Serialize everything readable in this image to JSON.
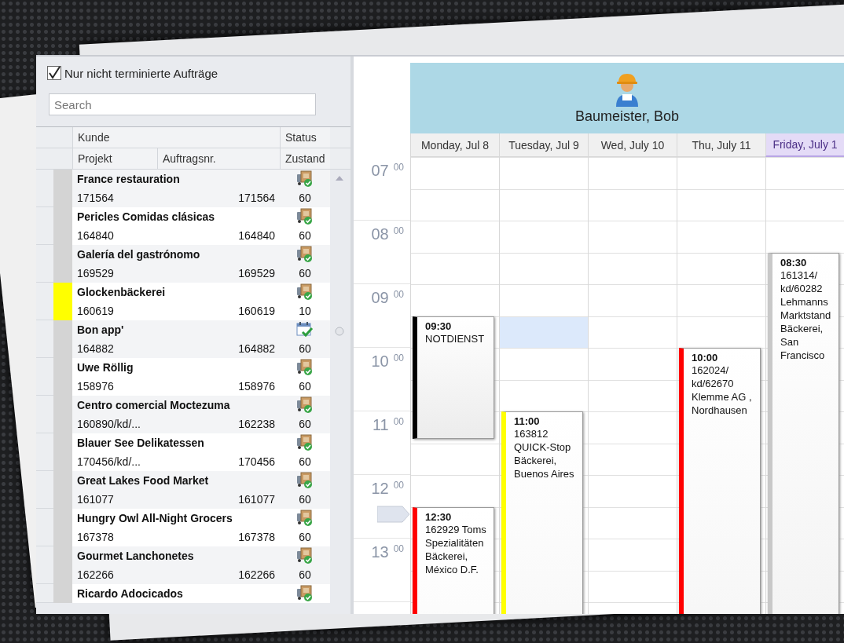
{
  "filter": {
    "label": "Nur nicht terminierte Aufträge",
    "checked": true
  },
  "search": {
    "placeholder": "Search"
  },
  "table": {
    "columns_top": [
      "Kunde",
      "Status"
    ],
    "columns_bottom": [
      "Projekt",
      "Auftragsnr.",
      "Zustand"
    ]
  },
  "orders": [
    {
      "customer": "France restauration",
      "project": "171564",
      "order_no": "171564",
      "state": "60",
      "kind": "truck",
      "color": "#d4d4d4"
    },
    {
      "customer": "Pericles Comidas clásicas",
      "project": "164840",
      "order_no": "164840",
      "state": "60",
      "kind": "truck",
      "color": "#d4d4d4"
    },
    {
      "customer": "Galería del gastrónomo",
      "project": "169529",
      "order_no": "169529",
      "state": "60",
      "kind": "truck",
      "color": "#d4d4d4"
    },
    {
      "customer": "Glockenbäckerei",
      "project": "160619",
      "order_no": "160619",
      "state": "10",
      "kind": "truck",
      "color": "#ffff00"
    },
    {
      "customer": "Bon app'",
      "project": "164882",
      "order_no": "164882",
      "state": "60",
      "kind": "calendar",
      "color": "#d4d4d4"
    },
    {
      "customer": "Uwe Röllig",
      "project": "158976",
      "order_no": "158976",
      "state": "60",
      "kind": "truck",
      "color": "#d4d4d4"
    },
    {
      "customer": "Centro comercial Moctezuma",
      "project": "160890/kd/...",
      "order_no": "162238",
      "state": "60",
      "kind": "truck",
      "color": "#d4d4d4"
    },
    {
      "customer": "Blauer See Delikatessen",
      "project": "170456/kd/...",
      "order_no": "170456",
      "state": "60",
      "kind": "truck",
      "color": "#d4d4d4"
    },
    {
      "customer": "Great Lakes Food Market",
      "project": "161077",
      "order_no": "161077",
      "state": "60",
      "kind": "truck",
      "color": "#d4d4d4"
    },
    {
      "customer": "Hungry Owl All-Night Grocers",
      "project": "167378",
      "order_no": "167378",
      "state": "60",
      "kind": "truck",
      "color": "#d4d4d4"
    },
    {
      "customer": "Gourmet Lanchonetes",
      "project": "162266",
      "order_no": "162266",
      "state": "60",
      "kind": "truck",
      "color": "#d4d4d4"
    },
    {
      "customer": "Ricardo Adocicados",
      "kind": "truck",
      "color": "#d4d4d4"
    }
  ],
  "calendar": {
    "resource": "Baumeister, Bob",
    "hours": [
      {
        "hour": "07",
        "minutes": "00",
        "now": false
      },
      {
        "hour": "08",
        "minutes": "00",
        "now": false
      },
      {
        "hour": "09",
        "minutes": "00",
        "now": false
      },
      {
        "hour": "10",
        "minutes": "00",
        "now": false
      },
      {
        "hour": "11",
        "minutes": "00",
        "now": false
      },
      {
        "hour": "12",
        "minutes": "00",
        "now": true
      },
      {
        "hour": "13",
        "minutes": "00",
        "now": false
      }
    ],
    "days": [
      {
        "label": "Monday, Jul 8",
        "highlighted": false,
        "slots": [
          {
            "selected": false
          },
          {
            "selected": false
          },
          {
            "selected": false
          },
          {
            "selected": false
          },
          {
            "selected": false
          },
          {
            "selected": false
          },
          {
            "selected": false
          },
          {
            "selected": false
          },
          {
            "selected": false
          },
          {
            "selected": false
          },
          {
            "selected": false
          },
          {
            "selected": false
          },
          {
            "selected": false
          },
          {
            "selected": false
          },
          {
            "selected": false
          }
        ],
        "appointments": [
          {
            "time": "09:30",
            "kind": "short",
            "text": "NOTDIENST",
            "color": "#000000"
          },
          {
            "time": "12:30",
            "kind": "open",
            "text": "162929 Toms Spezialitäten Bäckerei, México D.F.",
            "color": "#ff0000"
          }
        ]
      },
      {
        "label": "Tuesday, Jul 9",
        "highlighted": false,
        "slots": [
          {
            "selected": false
          },
          {
            "selected": false
          },
          {
            "selected": false
          },
          {
            "selected": false
          },
          {
            "selected": false
          },
          {
            "selected": true
          },
          {
            "selected": false
          },
          {
            "selected": false
          },
          {
            "selected": false
          },
          {
            "selected": false
          },
          {
            "selected": false
          },
          {
            "selected": false
          },
          {
            "selected": false
          },
          {
            "selected": false
          },
          {
            "selected": false
          }
        ],
        "appointments": [
          {
            "time": "11:00",
            "kind": "open",
            "text": "163812 QUICK-Stop Bäckerei, Buenos Aires",
            "color": "#ffff00"
          }
        ]
      },
      {
        "label": "Wed, July 10",
        "highlighted": false,
        "slots": [
          {
            "selected": false
          },
          {
            "selected": false
          },
          {
            "selected": false
          },
          {
            "selected": false
          },
          {
            "selected": false
          },
          {
            "selected": false
          },
          {
            "selected": false
          },
          {
            "selected": false
          },
          {
            "selected": false
          },
          {
            "selected": false
          },
          {
            "selected": false
          },
          {
            "selected": false
          },
          {
            "selected": false
          },
          {
            "selected": false
          },
          {
            "selected": false
          }
        ]
      },
      {
        "label": "Thu, July 11",
        "highlighted": false,
        "slots": [
          {
            "selected": false
          },
          {
            "selected": false
          },
          {
            "selected": false
          },
          {
            "selected": false
          },
          {
            "selected": false
          },
          {
            "selected": false
          },
          {
            "selected": false
          },
          {
            "selected": false
          },
          {
            "selected": false
          },
          {
            "selected": false
          },
          {
            "selected": false
          },
          {
            "selected": false
          },
          {
            "selected": false
          },
          {
            "selected": false
          },
          {
            "selected": false
          }
        ],
        "appointments": [
          {
            "time": "10:00",
            "kind": "open",
            "text": "162024/ kd/62670 Klemme AG , Nordhausen",
            "color": "#ff0000"
          }
        ]
      },
      {
        "label": "Friday, July 1",
        "highlighted": true,
        "slots": [
          {
            "selected": false
          },
          {
            "selected": false
          },
          {
            "selected": false
          },
          {
            "selected": false
          },
          {
            "selected": false
          },
          {
            "selected": false
          },
          {
            "selected": false
          },
          {
            "selected": false
          },
          {
            "selected": false
          },
          {
            "selected": false
          },
          {
            "selected": false
          },
          {
            "selected": false
          },
          {
            "selected": false
          },
          {
            "selected": false
          },
          {
            "selected": false
          }
        ],
        "appointments": [
          {
            "time": "08:30",
            "kind": "open",
            "text": "161314/ kd/60282 Lehmanns Marktstand Bäckerei, San Francisco",
            "color": "#c8c8c8"
          }
        ]
      }
    ]
  }
}
